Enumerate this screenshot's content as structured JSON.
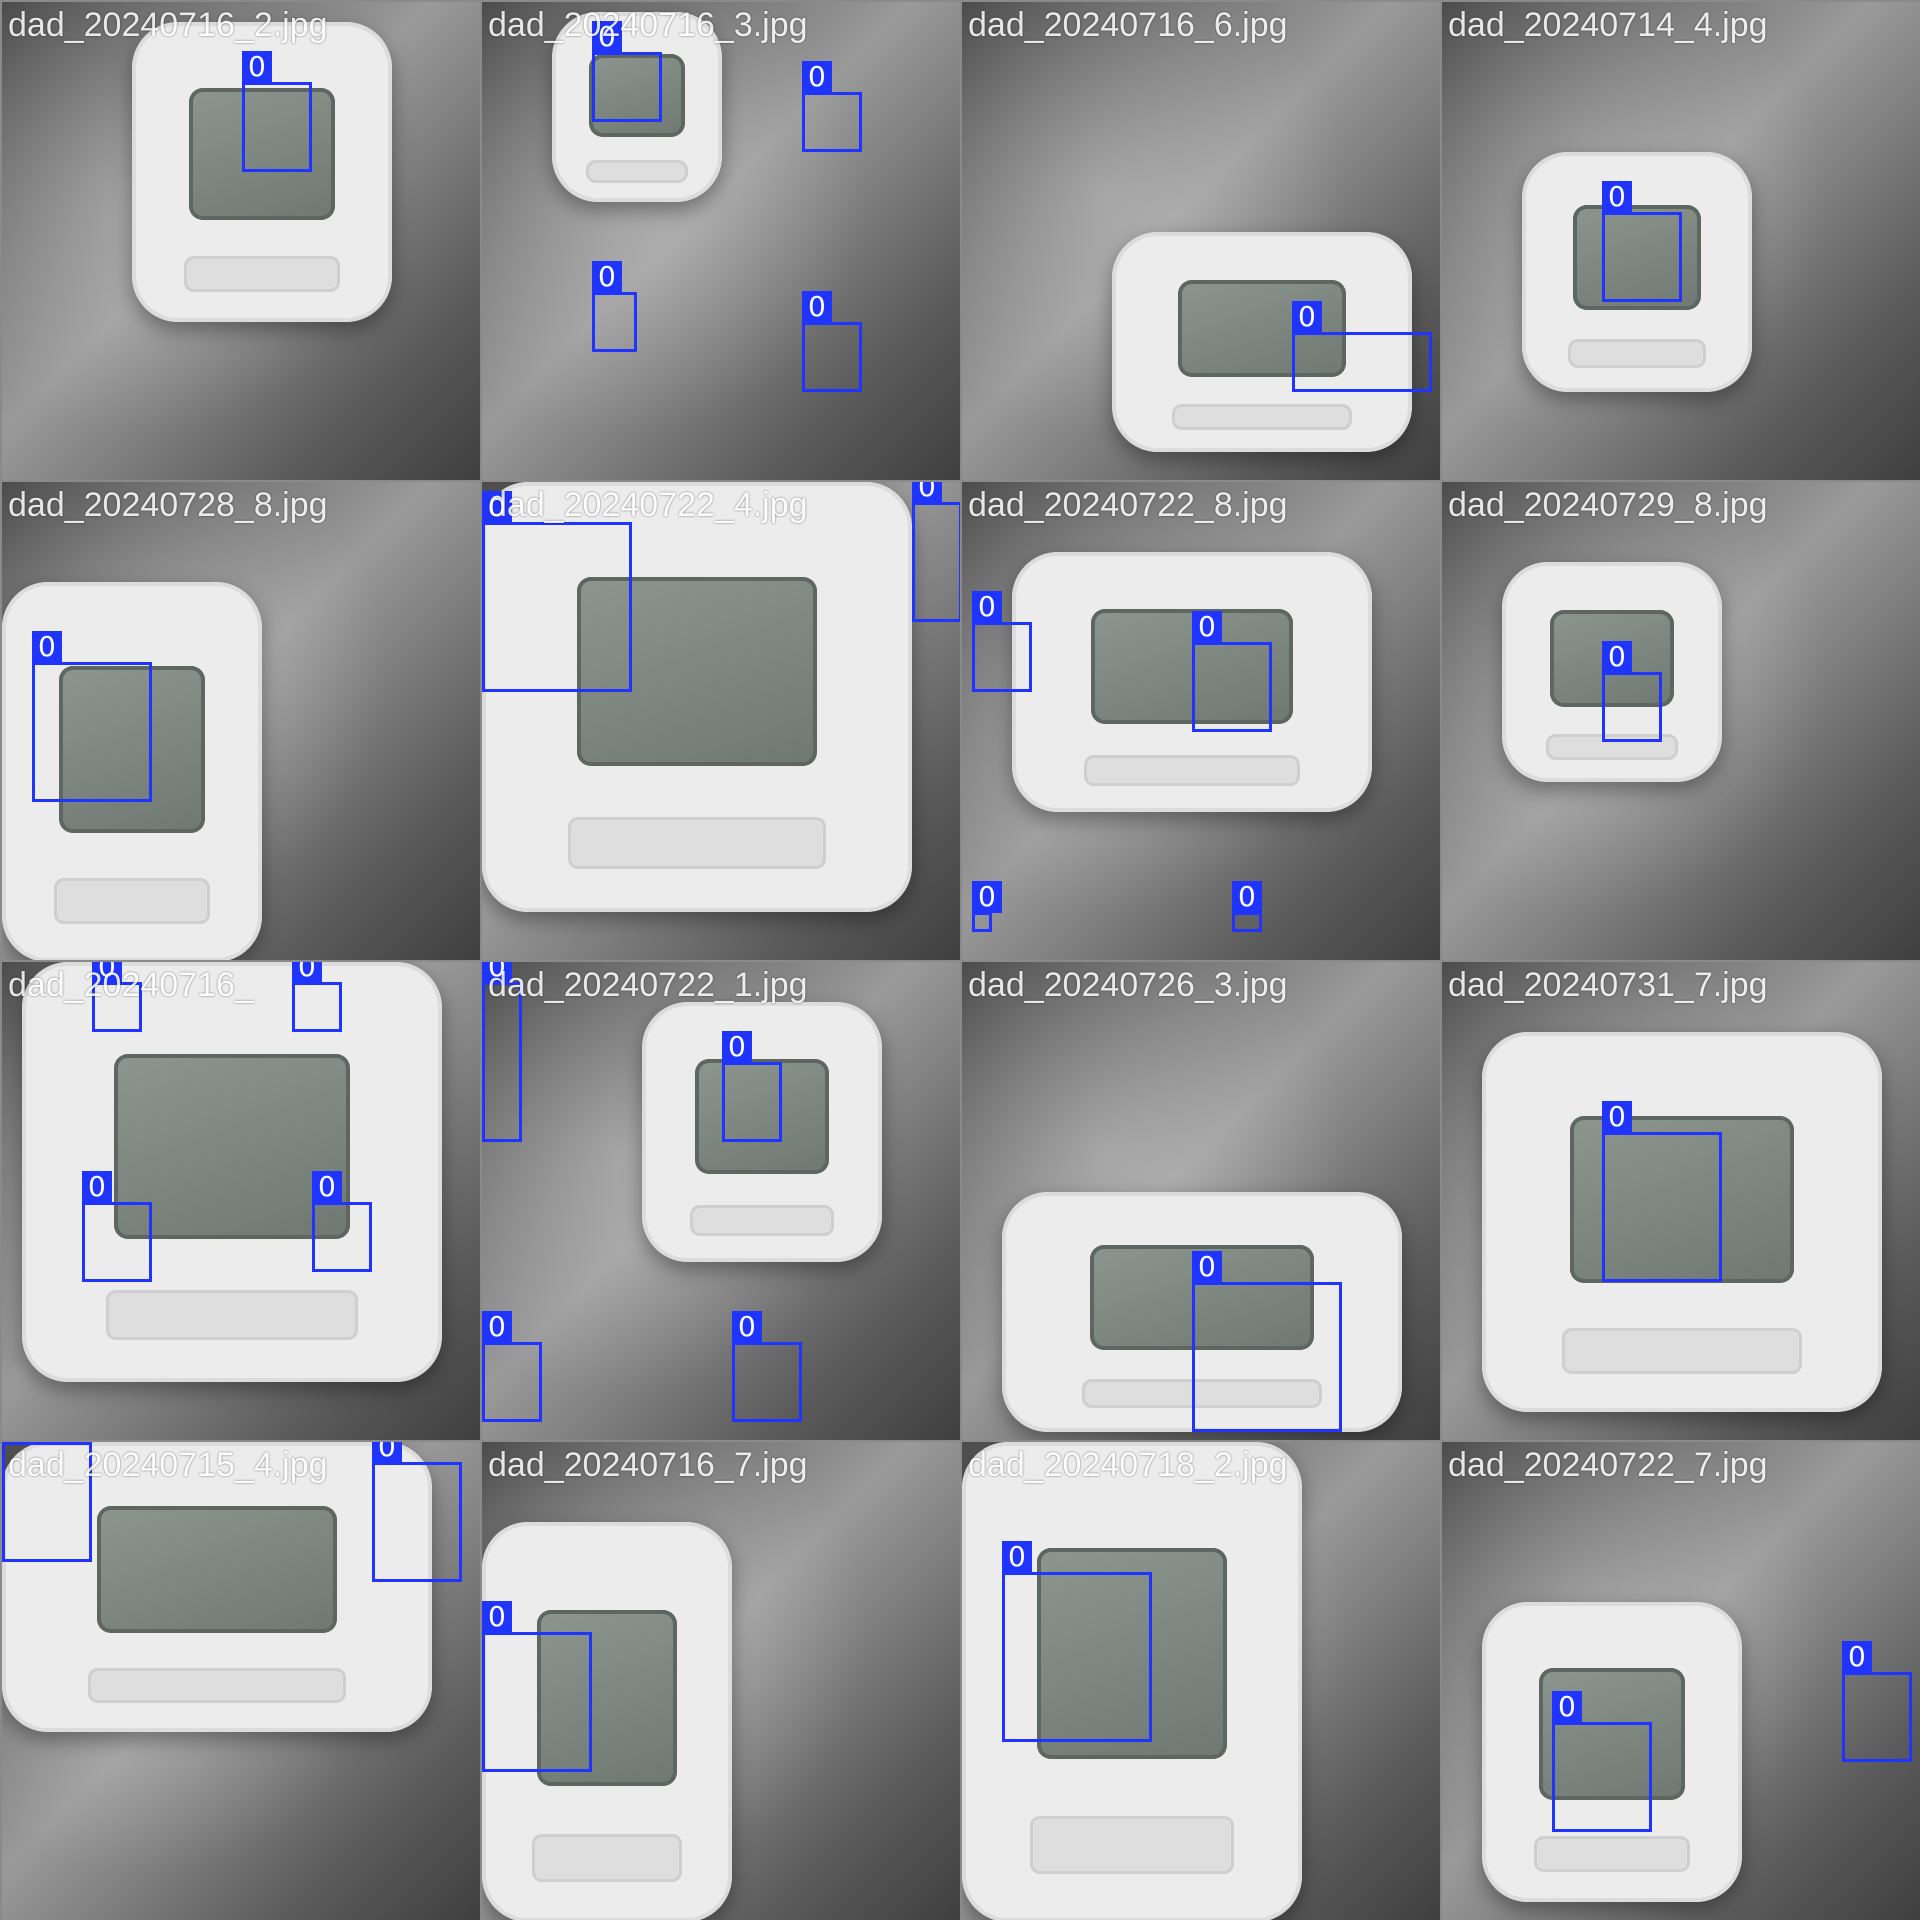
{
  "bbox_color": "#1f35ff",
  "tiles": [
    {
      "filename": "dad_20240716_2.jpg",
      "boxes": [
        {
          "label": "0"
        }
      ]
    },
    {
      "filename": "dad_20240716_3.jpg",
      "boxes": [
        {
          "label": "0"
        },
        {
          "label": "0"
        },
        {
          "label": "0"
        },
        {
          "label": "0"
        }
      ]
    },
    {
      "filename": "dad_20240716_6.jpg",
      "boxes": [
        {
          "label": "0"
        }
      ]
    },
    {
      "filename": "dad_20240714_4.jpg",
      "boxes": [
        {
          "label": "0"
        }
      ]
    },
    {
      "filename": "dad_20240728_8.jpg",
      "boxes": [
        {
          "label": "0"
        }
      ]
    },
    {
      "filename": "dad_20240722_4.jpg",
      "boxes": [
        {
          "label": "0"
        },
        {
          "label": "0"
        }
      ]
    },
    {
      "filename": "dad_20240722_8.jpg",
      "boxes": [
        {
          "label": "0"
        },
        {
          "label": "0"
        },
        {
          "label": "0"
        },
        {
          "label": "0"
        }
      ]
    },
    {
      "filename": "dad_20240729_8.jpg",
      "boxes": [
        {
          "label": "0"
        }
      ]
    },
    {
      "filename": "dad_20240716_",
      "boxes": [
        {
          "label": "0"
        },
        {
          "label": "0"
        },
        {
          "label": "0"
        },
        {
          "label": "0"
        }
      ]
    },
    {
      "filename": "dad_20240722_1.jpg",
      "boxes": [
        {
          "label": "0"
        },
        {
          "label": "0"
        },
        {
          "label": "0"
        },
        {
          "label": "0"
        }
      ]
    },
    {
      "filename": "dad_20240726_3.jpg",
      "boxes": [
        {
          "label": "0"
        }
      ]
    },
    {
      "filename": "dad_20240731_7.jpg",
      "boxes": [
        {
          "label": "0"
        }
      ]
    },
    {
      "filename": "dad_20240715_4.jpg",
      "boxes": [
        {
          "label": "0"
        },
        {
          "label": "0"
        }
      ]
    },
    {
      "filename": "dad_20240716_7.jpg",
      "boxes": [
        {
          "label": "0"
        }
      ]
    },
    {
      "filename": "dad_20240718_2.jpg",
      "boxes": [
        {
          "label": "0"
        }
      ]
    },
    {
      "filename": "dad_20240722_7.jpg",
      "boxes": [
        {
          "label": "0"
        },
        {
          "label": "0"
        }
      ]
    }
  ]
}
